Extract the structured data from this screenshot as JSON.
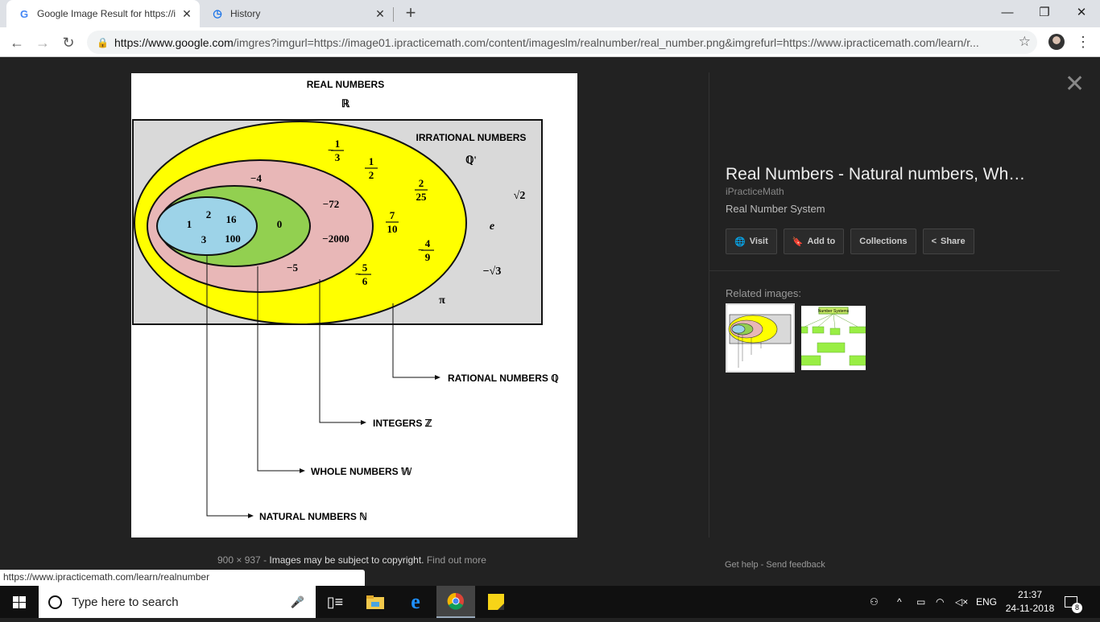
{
  "tabs": [
    {
      "label": "Google Image Result for https://i",
      "icon": "google-g-icon"
    },
    {
      "label": "History",
      "icon": "history-icon"
    }
  ],
  "address": {
    "url_host": "https://www.google.com",
    "url_rest": "/imgres?imgurl=https://image01.ipracticemath.com/content/imageslm/realnumber/real_number.png&imgrefurl=https://www.ipracticemath.com/learn/r..."
  },
  "diagram": {
    "title": "REAL NUMBERS",
    "title_symbol": "ℝ",
    "irrational_label": "IRRATIONAL NUMBERS",
    "irrational_symbol": "ℚ'",
    "natural_values": [
      "1",
      "2",
      "16",
      "3",
      "100"
    ],
    "whole_values": [
      "0"
    ],
    "integer_values": [
      "−4",
      "−72",
      "−2000",
      "−5"
    ],
    "rational_fractions": [
      {
        "sign": "−",
        "num": "1",
        "den": "3"
      },
      {
        "sign": "",
        "num": "1",
        "den": "2"
      },
      {
        "sign": "",
        "num": "2",
        "den": "25"
      },
      {
        "sign": "",
        "num": "7",
        "den": "10"
      },
      {
        "sign": "−",
        "num": "4",
        "den": "9"
      },
      {
        "sign": "−",
        "num": "5",
        "den": "6"
      }
    ],
    "irrational_values": [
      "√2",
      "e",
      "−√3",
      "π"
    ],
    "set_labels": {
      "rational": "RATIONAL NUMBERS ℚ",
      "integers": "INTEGERS ℤ",
      "whole": "WHOLE NUMBERS 𝕎",
      "natural": "NATURAL NUMBERS ℕ"
    }
  },
  "image_meta": {
    "size": "900 × 937",
    "separator": "-",
    "copyright": "Images may be subject to copyright.",
    "find_out": "Find out more"
  },
  "panel": {
    "title": "Real Numbers - Natural numbers, Wh…",
    "site": "iPracticeMath",
    "description": "Real Number System",
    "buttons": {
      "visit": "Visit",
      "add_to": "Add to",
      "collections": "Collections",
      "share": "Share"
    },
    "related_label": "Related images:",
    "thumb2_title": "Number Systems",
    "help": "Get help",
    "sep": "-",
    "feedback": "Send feedback"
  },
  "status_url": "https://www.ipracticemath.com/learn/realnumber",
  "taskbar": {
    "search_placeholder": "Type here to search",
    "lang": "ENG",
    "time": "21:37",
    "date": "24-11-2018",
    "notif_count": "8"
  },
  "colors": {
    "yellow": "#ffff00",
    "pink": "#e8b7b7",
    "green": "#92d050",
    "blue": "#9dd3e8",
    "grey": "#d9d9d9"
  }
}
